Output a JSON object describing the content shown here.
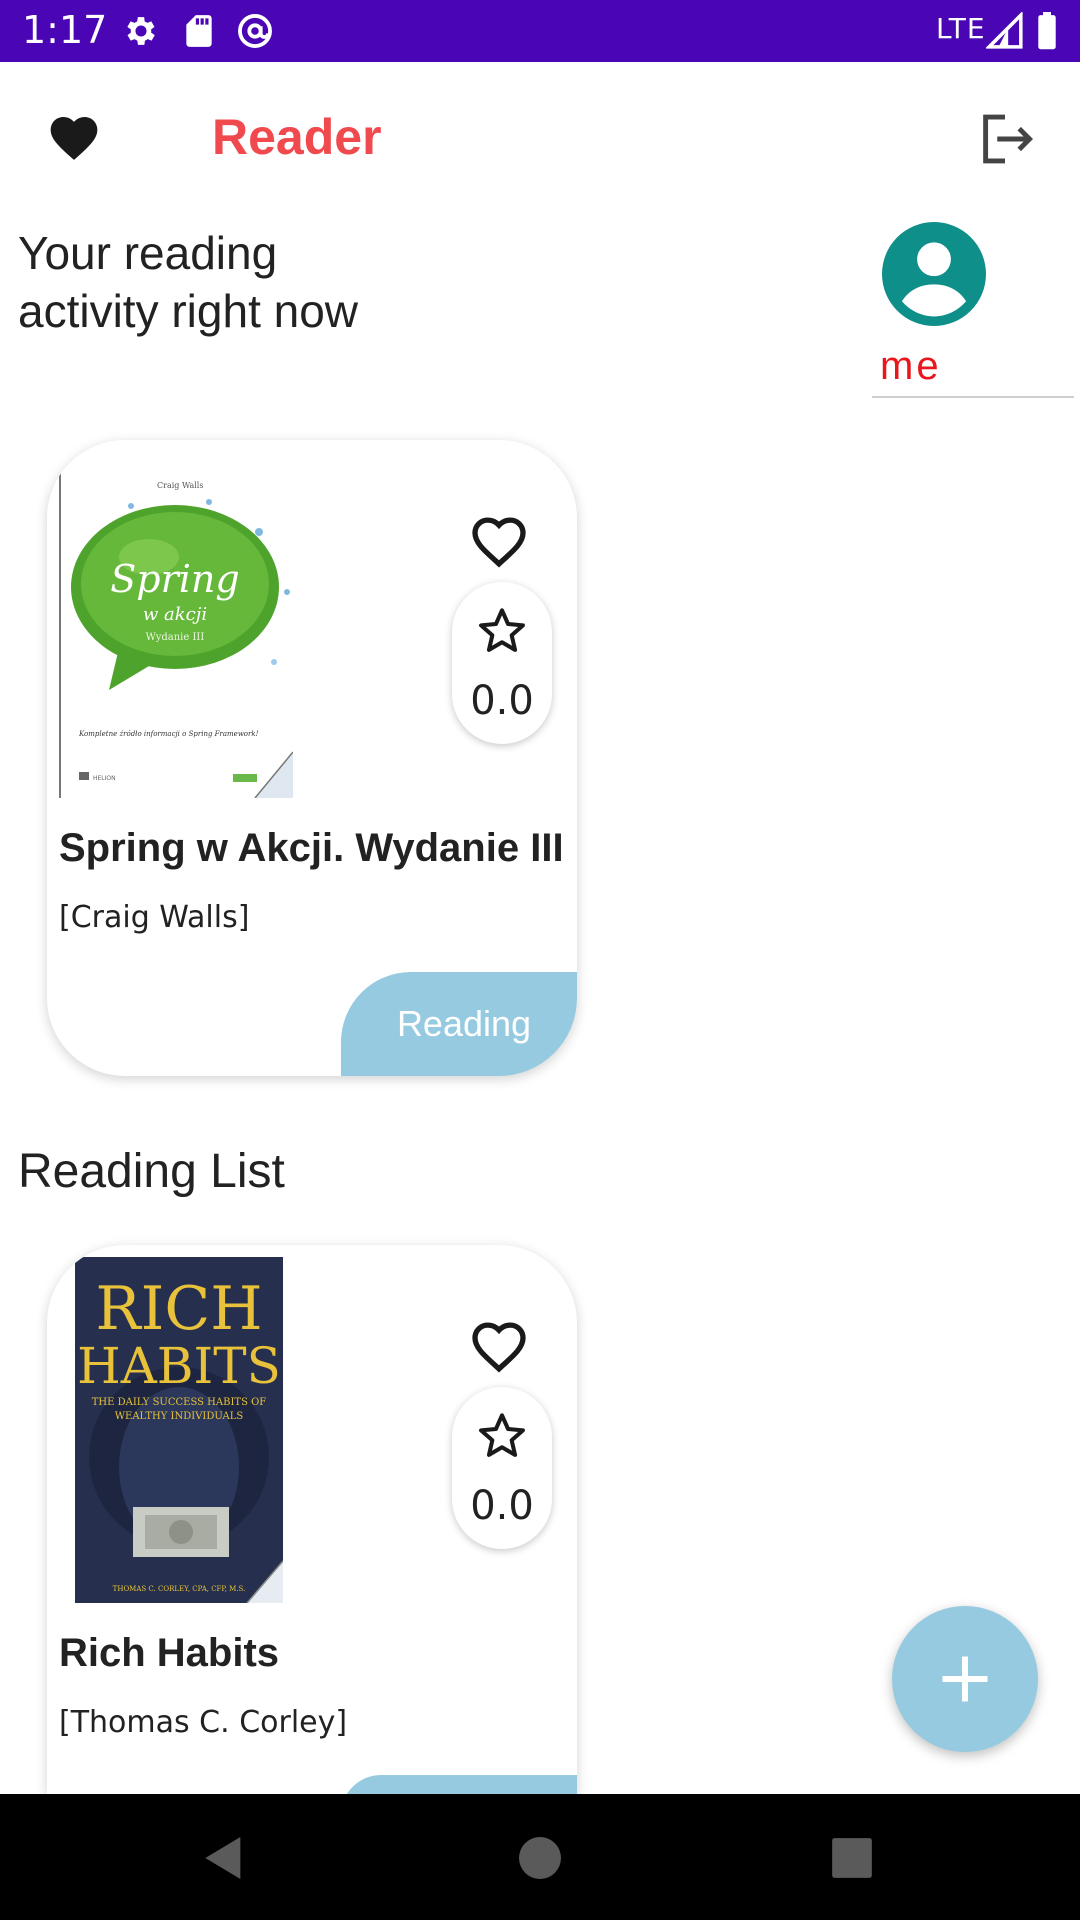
{
  "status_bar": {
    "time": "1:17",
    "network": "LTE",
    "icons": [
      "settings-icon",
      "sd-card-icon",
      "at-sign-icon",
      "signal-icon",
      "battery-icon"
    ],
    "background": "#4a06b5"
  },
  "app_bar": {
    "title": "Reader",
    "title_color": "#f04a4f",
    "icons": [
      "heart-filled-icon",
      "logout-icon"
    ]
  },
  "activity": {
    "heading": "Your reading\n activity right now"
  },
  "profile": {
    "username": "me",
    "avatar_color": "#0f8f8a",
    "username_color": "#e9161c"
  },
  "current_books": [
    {
      "cover_title": "Spring w akcji",
      "cover_author": "Craig Walls",
      "cover_edition": "Wydanie III",
      "cover_tagline": "Kompletne źródło informacji o Spring Framework!",
      "cover_publisher": "HELION",
      "title": "Spring w Akcji. Wydanie III",
      "author": "[Craig Walls]",
      "rating": "0.0",
      "status": "Reading"
    }
  ],
  "reading_list": {
    "heading": "Reading List",
    "books": [
      {
        "cover_title_line1": "RICH",
        "cover_title_line2": "HABITS",
        "cover_subtitle_line1": "THE DAILY SUCCESS HABITS OF",
        "cover_subtitle_line2": "WEALTHY INDIVIDUALS",
        "cover_author": "THOMAS C. CORLEY, CPA, CFP, M.S.",
        "title": "Rich Habits",
        "author": "[Thomas C. Corley]",
        "rating": "0.0"
      }
    ]
  },
  "fab": {
    "icon": "plus-icon",
    "color": "#95cae0"
  },
  "nav_bar": {
    "icons": [
      "back-icon",
      "home-icon",
      "recents-icon"
    ]
  }
}
